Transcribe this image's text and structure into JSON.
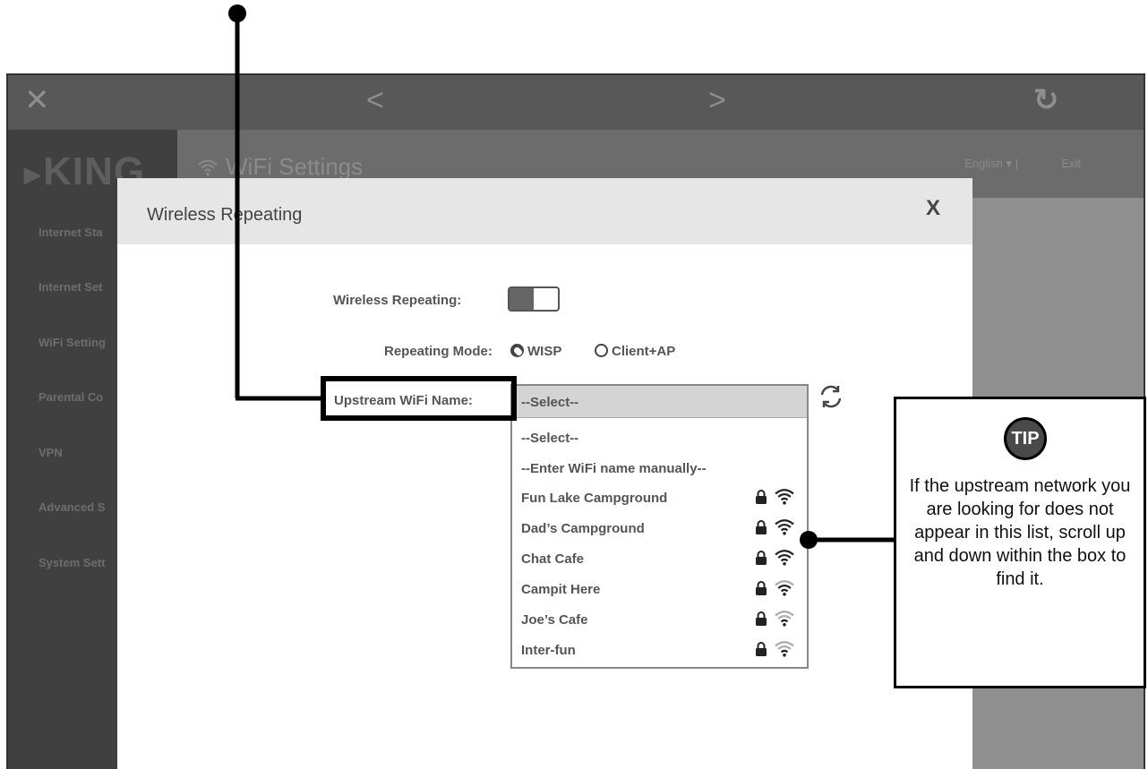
{
  "nav": {
    "close": "✕",
    "back": "<",
    "forward": ">",
    "refresh": "↻"
  },
  "brand": {
    "logo": "KING"
  },
  "sidebar": {
    "items": [
      {
        "label": "Internet Sta"
      },
      {
        "label": "Internet Set"
      },
      {
        "label": "WiFi Setting"
      },
      {
        "label": "Parental Co"
      },
      {
        "label": "VPN"
      },
      {
        "label": "Advanced S"
      },
      {
        "label": "System Sett"
      }
    ]
  },
  "header": {
    "title": "WiFi Settings",
    "language": "English",
    "exit": "Exit"
  },
  "modal": {
    "title": "Wireless Repeating",
    "close": "X",
    "wireless_repeating_label": "Wireless Repeating:",
    "repeating_mode_label": "Repeating Mode:",
    "mode_options": [
      "WISP",
      "Client+AP"
    ],
    "mode_selected": "WISP",
    "upstream_label": "Upstream WiFi Name:",
    "dropdown": {
      "selected": "--Select--",
      "options": [
        {
          "label": "--Select--"
        },
        {
          "label": "--Enter WiFi name manually--"
        },
        {
          "label": "Fun Lake Campground",
          "locked": true,
          "signal": 4
        },
        {
          "label": "Dad’s Campground",
          "locked": true,
          "signal": 4
        },
        {
          "label": "Chat Cafe",
          "locked": true,
          "signal": 4
        },
        {
          "label": "Campit Here",
          "locked": true,
          "signal": 3
        },
        {
          "label": "Joe’s Cafe",
          "locked": true,
          "signal": 2
        },
        {
          "label": "Inter-fun",
          "locked": true,
          "signal": 2
        }
      ]
    }
  },
  "tip": {
    "badge": "TIP",
    "text": "If the upstream network you are looking for does not appear in this list, scroll up and down within the box to find it."
  },
  "icons": {
    "lock": "lock-icon",
    "wifi": "wifi-icon",
    "refresh": "refresh-icon"
  }
}
